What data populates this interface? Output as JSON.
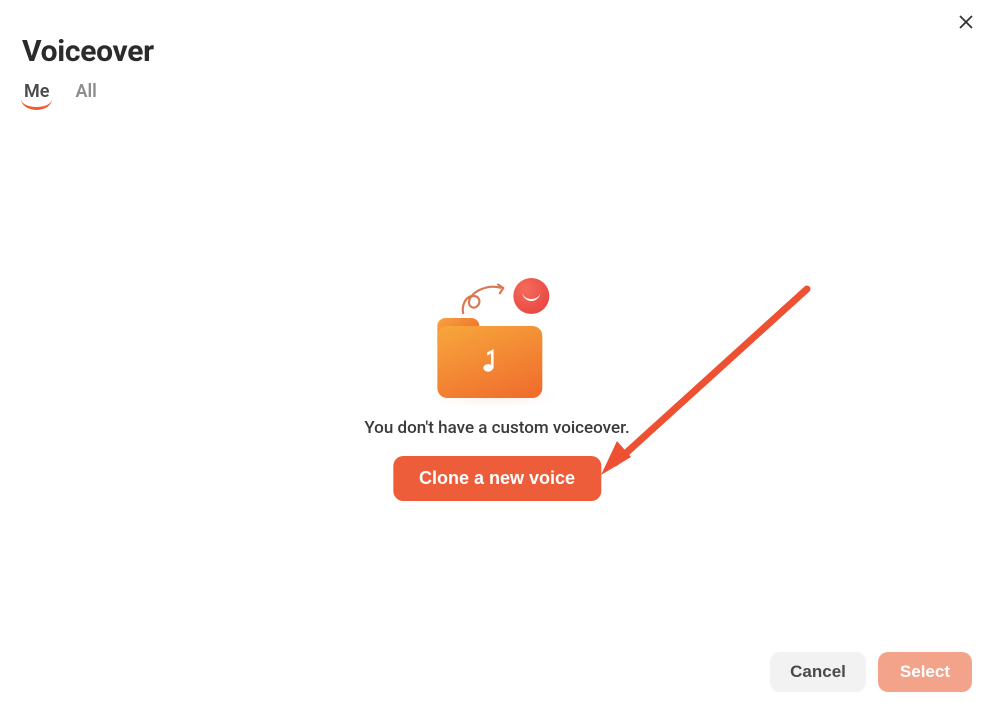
{
  "modal": {
    "title": "Voiceover",
    "tabs": [
      {
        "label": "Me",
        "active": true
      },
      {
        "label": "All",
        "active": false
      }
    ],
    "empty_state": {
      "message": "You don't have a custom voiceover.",
      "cta_label": "Clone a new voice"
    },
    "footer": {
      "cancel_label": "Cancel",
      "select_label": "Select"
    }
  },
  "colors": {
    "accent": "#ee5d3a",
    "text_primary": "#2b2b2b",
    "text_muted": "#8d8d8d",
    "select_disabled": "#f4a38b"
  }
}
